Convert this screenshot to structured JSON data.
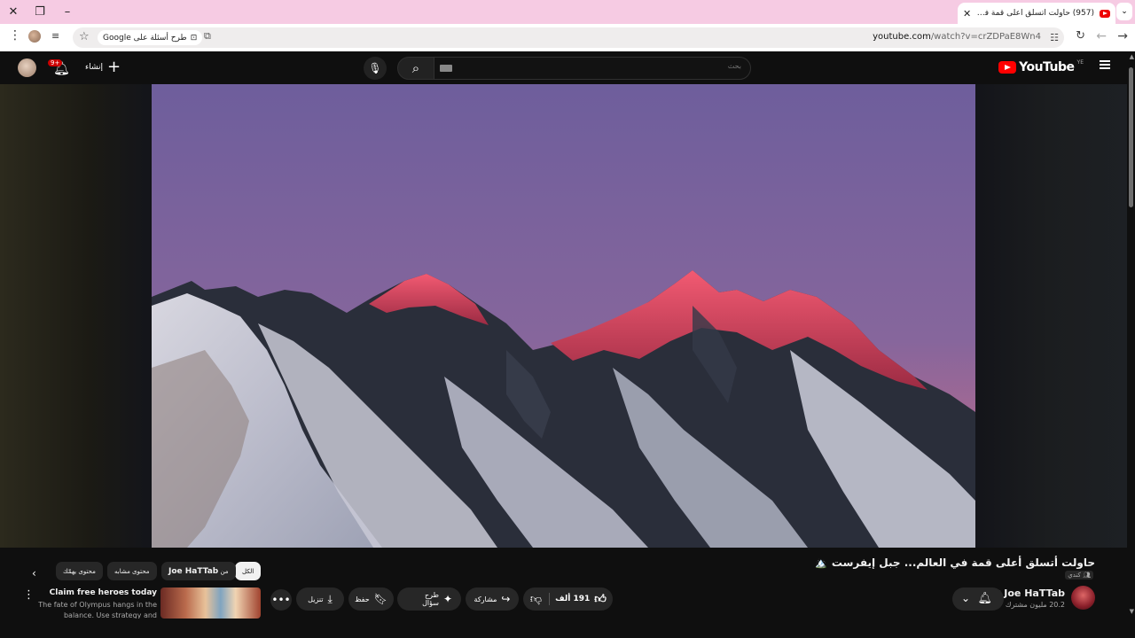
{
  "browser": {
    "tab_title": "(957) حاولت أتسلق أعلى قمة في...",
    "url_host": "youtube.com",
    "url_path": "/watch?v=crZDPaE8Wn4",
    "ask_google_label": "طرح أسئلة على Google",
    "icons": [
      "close-window-icon",
      "restore-window-icon",
      "minimize-window-icon",
      "new-tab-icon",
      "tab-search-icon",
      "back-icon",
      "forward-icon",
      "reload-icon",
      "star-icon",
      "cast-icon",
      "menu-icon"
    ]
  },
  "header": {
    "logo_text": "YouTube",
    "logo_country": "YE",
    "search_placeholder": "بحث",
    "create_label": "إنشاء",
    "notification_badge": "9+"
  },
  "video": {
    "title": "حاولت أتسلق أعلى قمة في العالم... جبل إيفرست",
    "title_emoji": "🏔️",
    "tag": "كندي"
  },
  "channel": {
    "name": "Joe HaTTab",
    "subscribers": "20.2 مليون مشترك"
  },
  "actions": {
    "likes": "191 ألف",
    "share": "مشاركة",
    "ask": "طرح سؤال",
    "save": "حفظ",
    "download": "تنزيل"
  },
  "ad": {
    "title": "Claim free heroes today",
    "description": "The fate of Olympus hangs in the balance. Use strategy and positioning"
  },
  "filters": {
    "all": "الكل",
    "from_channel_prefix": "من",
    "from_channel_name": "Joe HaTTab",
    "related": "محتوى مشابه",
    "for_you": "محتوى يهمّك"
  },
  "colors": {
    "page_bg": "#0f0f0f",
    "chrome_tab_bar": "#f6cbe3",
    "youtube_red": "#ff0000",
    "pill_bg": "#272727"
  }
}
